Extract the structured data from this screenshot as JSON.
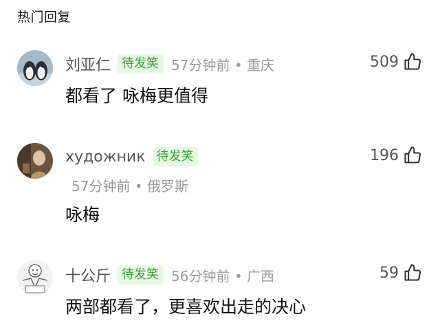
{
  "section": {
    "title": "热门回复"
  },
  "comments": [
    {
      "username": "刘亚仁",
      "badge": "待发笑",
      "time": "57分钟前",
      "location": "重庆",
      "meta": "57分钟前 • 重庆",
      "text": "都看了 咏梅更值得",
      "likes": "509",
      "avatar_icon": "penguins-avatar"
    },
    {
      "username": "художник",
      "badge": "待发笑",
      "time": "57分钟前",
      "location": "俄罗斯",
      "meta": "57分钟前 • 俄罗斯",
      "text": "咏梅",
      "likes": "196",
      "avatar_icon": "figure-avatar"
    },
    {
      "username": "十公斤",
      "badge": "待发笑",
      "time": "56分钟前",
      "location": "广西",
      "meta": "56分钟前 • 广西",
      "text": "两部都看了，更喜欢出走的决心",
      "likes": "59",
      "avatar_icon": "meme-avatar"
    }
  ],
  "colors": {
    "badge_text": "#3aa03a",
    "badge_bg": "#e8f6e4",
    "meta_text": "#9a9a9a",
    "username_text": "#555555"
  },
  "icons": {
    "like": "thumbs-up-icon"
  }
}
